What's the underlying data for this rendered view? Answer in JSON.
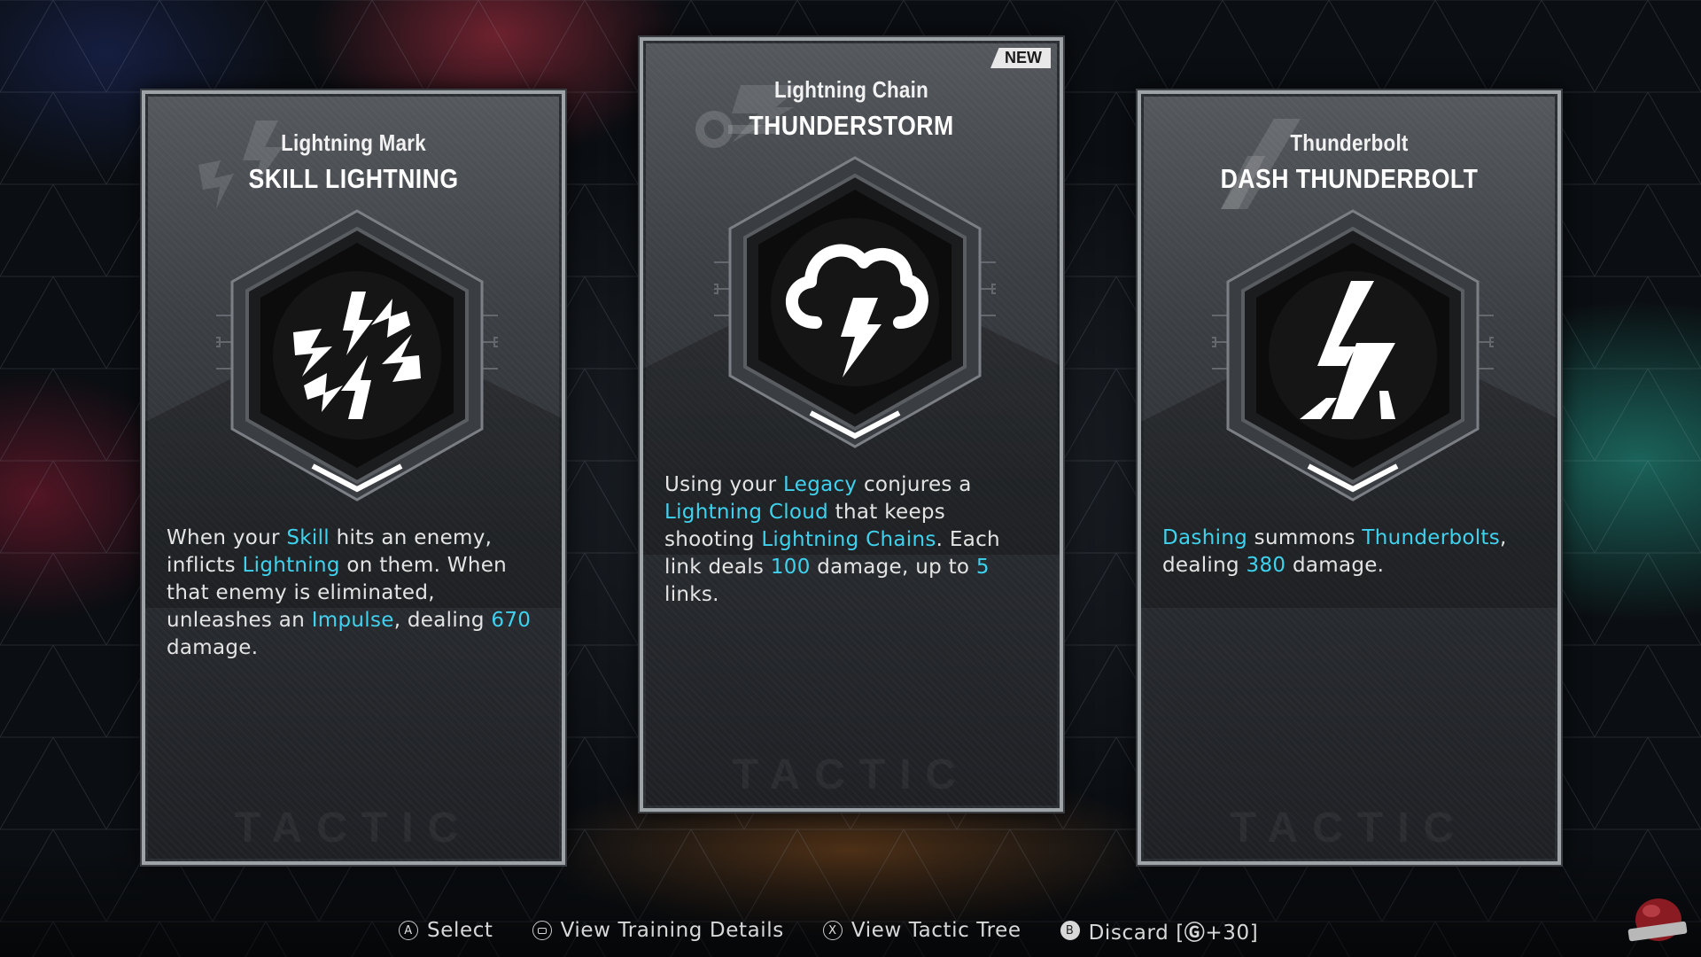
{
  "cards": [
    {
      "subtitle": "Lightning Mark",
      "title": "SKILL LIGHTNING",
      "icon": "lightning-burst-icon",
      "description": [
        {
          "t": "When your "
        },
        {
          "t": "Skill",
          "hl": true
        },
        {
          "t": " hits an enemy, inflicts "
        },
        {
          "t": "Lightning",
          "hl": true
        },
        {
          "t": " on them. When that enemy is eliminated, unleashes an "
        },
        {
          "t": "Impulse",
          "hl": true
        },
        {
          "t": ", dealing "
        },
        {
          "t": "670",
          "hl": true
        },
        {
          "t": " damage."
        }
      ],
      "watermark": "TACTIC"
    },
    {
      "subtitle": "Lightning Chain",
      "title": "THUNDERSTORM",
      "icon": "storm-cloud-icon",
      "badge": "NEW",
      "description": [
        {
          "t": "Using your "
        },
        {
          "t": "Legacy",
          "hl": true
        },
        {
          "t": " conjures a "
        },
        {
          "t": "Lightning Cloud",
          "hl": true
        },
        {
          "t": " that keeps shooting "
        },
        {
          "t": "Lightning Chains",
          "hl": true
        },
        {
          "t": ". Each link deals "
        },
        {
          "t": "100",
          "hl": true
        },
        {
          "t": " damage, up to "
        },
        {
          "t": "5",
          "hl": true
        },
        {
          "t": " links."
        }
      ],
      "watermark": "TACTIC"
    },
    {
      "subtitle": "Thunderbolt",
      "title": "DASH THUNDERBOLT",
      "icon": "thunderbolt-icon",
      "description": [
        {
          "t": "Dashing",
          "hl": true
        },
        {
          "t": " summons "
        },
        {
          "t": "Thunderbolts",
          "hl": true
        },
        {
          "t": ", dealing "
        },
        {
          "t": "380",
          "hl": true
        },
        {
          "t": " damage."
        }
      ],
      "watermark": "TACTIC"
    }
  ],
  "footer": {
    "select": {
      "button": "A",
      "label": "Select"
    },
    "details": {
      "label": "View Training Details"
    },
    "tree": {
      "button": "X",
      "label": "View Tactic Tree"
    },
    "discard": {
      "button": "B",
      "label_prefix": "Discard [",
      "amount": "+30",
      "label_suffix": "]"
    }
  },
  "colors": {
    "highlight": "#3fd2ee",
    "card_border": "#9ea3a8"
  },
  "watermark_logo": "PLAYGROUND"
}
